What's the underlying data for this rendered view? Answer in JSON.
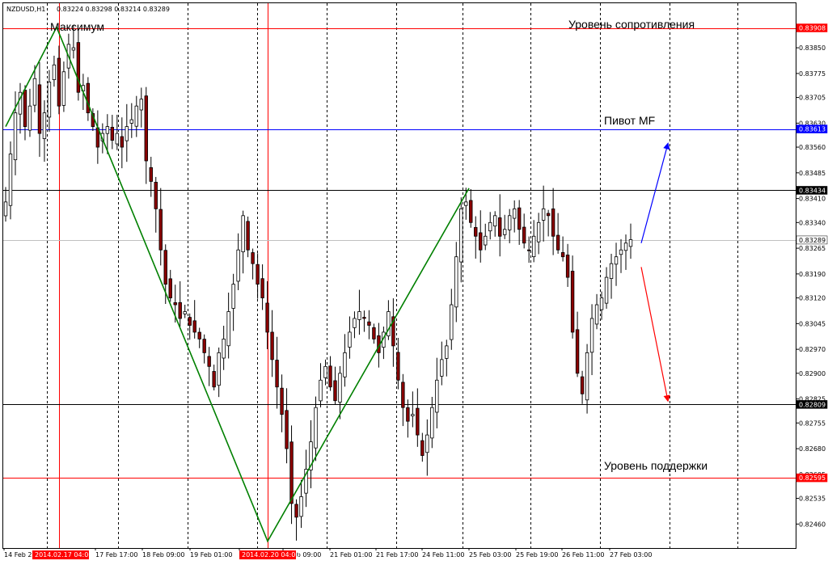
{
  "header": {
    "symbol": "NZDUSD,H1",
    "ohlc": "0.83224 0.83298 0.83214 0.83289"
  },
  "annotations": {
    "maximum": "Максимум",
    "resistance": "Уровень сопротивления",
    "pivot": "Пивот MF",
    "support": "Уровень поддержки"
  },
  "colors": {
    "bull": "#000000",
    "bear": "#8b0000",
    "wick": "#000000",
    "grid": "#000000",
    "resistance_line": "#ff0000",
    "pivot_line": "#0000ff",
    "black_level": "#000000",
    "current_price_line": "#c0c0c0",
    "zigzag": "#008000",
    "arrow_up": "#0000ff",
    "arrow_down": "#ff0000",
    "vline": "#ff0000"
  },
  "chart_data": {
    "type": "candlestick",
    "instrument": "NZDUSD",
    "timeframe": "H1",
    "ylim": [
      0.8239,
      0.8398
    ],
    "y_ticks": [
      "0.83850",
      "0.83775",
      "0.83705",
      "0.83630",
      "0.83560",
      "0.83485",
      "0.83410",
      "0.83340",
      "0.83265",
      "0.83190",
      "0.83120",
      "0.83045",
      "0.82970",
      "0.82900",
      "0.82825",
      "0.82755",
      "0.82680",
      "0.82605",
      "0.82535",
      "0.82460"
    ],
    "x_ticks": [
      "14 Feb 2014",
      "17 Feb 17:00",
      "18 Feb 09:00",
      "19 Feb 01:00",
      "19 Feb 09:00",
      "21 Feb 01:00",
      "21 Feb 17:00",
      "24 Feb 11:00",
      "25 Feb 03:00",
      "25 Feb 19:00",
      "26 Feb 11:00",
      "27 Feb 03:00"
    ],
    "x_tick_display": [
      "14 Feb 2",
      "17 Feb 17:00",
      "18 Feb 09:00",
      "19 Feb 01:00",
      "1",
      "9 Feb 09:00",
      "21 Feb 01:00",
      "21 Feb 17:00",
      "24 Feb 11:00",
      "25 Feb 03:00",
      "25 Feb 19:00",
      "26 Feb 11:00",
      "27 Feb 03:00"
    ],
    "marked_times": [
      "2014.02.17 04:00",
      "2014.02.20 04:00"
    ],
    "levels": [
      {
        "label": "0.83908",
        "value": 0.83908,
        "role": "resistance",
        "color": "#ff0000"
      },
      {
        "label": "0.83613",
        "value": 0.83613,
        "role": "pivot",
        "color": "#0000ff"
      },
      {
        "label": "0.83434",
        "value": 0.83434,
        "role": "level",
        "color": "#000000"
      },
      {
        "label": "0.83289",
        "value": 0.83289,
        "role": "current",
        "color": "#c0c0c0"
      },
      {
        "label": "0.82809",
        "value": 0.82809,
        "role": "level",
        "color": "#000000"
      },
      {
        "label": "0.82595",
        "value": 0.82595,
        "role": "support",
        "color": "#ff0000"
      }
    ],
    "zigzag": [
      {
        "t": "14 Feb 2014",
        "price": 0.8362
      },
      {
        "t": "2014.02.17 04:00",
        "price": 0.8391
      },
      {
        "t": "2014.02.20 04:00",
        "price": 0.8241
      },
      {
        "t": "24 Feb 15:00",
        "price": 0.8344
      }
    ],
    "projection_arrows": [
      {
        "direction": "up",
        "from": 0.8328,
        "to": 0.8357,
        "color": "#0000ff"
      },
      {
        "direction": "down",
        "from": 0.8321,
        "to": 0.8282,
        "color": "#ff0000"
      }
    ],
    "close_path": [
      0.834,
      0.8354,
      0.8366,
      0.8372,
      0.8362,
      0.8368,
      0.8376,
      0.836,
      0.8366,
      0.8375,
      0.838,
      0.8368,
      0.8378,
      0.8386,
      0.8385,
      0.8372,
      0.8374,
      0.8366,
      0.8362,
      0.8356,
      0.836,
      0.8362,
      0.8358,
      0.836,
      0.8356,
      0.8362,
      0.8364,
      0.8368,
      0.837,
      0.8352,
      0.8346,
      0.8338,
      0.8326,
      0.8316,
      0.8312,
      0.831,
      0.8306,
      0.8308,
      0.8304,
      0.8302,
      0.83,
      0.8296,
      0.8292,
      0.8286,
      0.8296,
      0.83,
      0.8308,
      0.8316,
      0.8326,
      0.8336,
      0.8326,
      0.8322,
      0.8316,
      0.8312,
      0.8302,
      0.8294,
      0.8286,
      0.8278,
      0.8268,
      0.8252,
      0.8248,
      0.8254,
      0.8262,
      0.827,
      0.828,
      0.8288,
      0.8292,
      0.8286,
      0.8282,
      0.829,
      0.8296,
      0.8302,
      0.8306,
      0.8308,
      0.8306,
      0.8304,
      0.83,
      0.8296,
      0.8302,
      0.8308,
      0.8298,
      0.8288,
      0.828,
      0.8276,
      0.8278,
      0.8272,
      0.8266,
      0.8272,
      0.828,
      0.8288,
      0.8294,
      0.8298,
      0.831,
      0.8324,
      0.8338,
      0.834,
      0.8334,
      0.833,
      0.8326,
      0.833,
      0.8334,
      0.8336,
      0.833,
      0.8332,
      0.8336,
      0.8338,
      0.8332,
      0.8328,
      0.8326,
      0.833,
      0.8334,
      0.8338,
      0.8336,
      0.833,
      0.8326,
      0.8324,
      0.8318,
      0.8302,
      0.829,
      0.8284,
      0.8296,
      0.8306,
      0.831,
      0.8312,
      0.8318,
      0.8322,
      0.8324,
      0.8326,
      0.8328,
      0.8329
    ]
  }
}
